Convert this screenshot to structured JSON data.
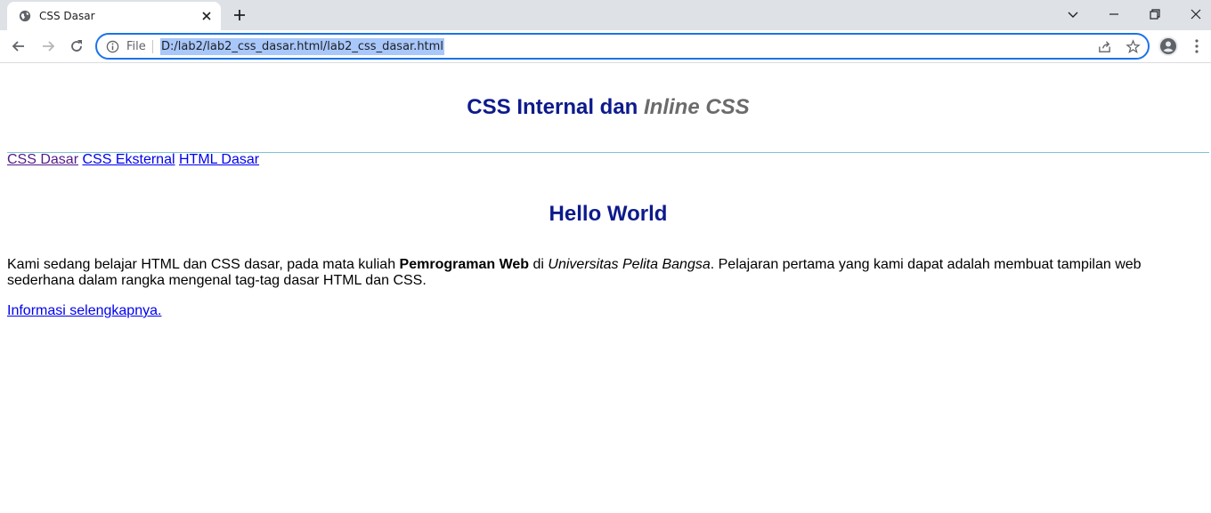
{
  "browser": {
    "tab_title": "CSS Dasar",
    "file_label": "File",
    "url": "D:/lab2/lab2_css_dasar.html/lab2_css_dasar.html",
    "accent_color": "#1a73e8"
  },
  "page": {
    "header": {
      "title_part1": "CSS Internal dan ",
      "title_part2": "Inline CSS"
    },
    "nav": [
      {
        "label": "CSS Dasar"
      },
      {
        "label": "CSS Eksternal"
      },
      {
        "label": "HTML Dasar"
      }
    ],
    "heading": "Hello World",
    "paragraph": {
      "text1": "Kami sedang belajar HTML dan CSS dasar, pada mata kuliah ",
      "bold": "Pemrograman Web",
      "text2": " di ",
      "italic": "Universitas Pelita Bangsa",
      "text3": ". Pelajaran pertama yang kami dapat adalah membuat tampilan web sederhana dalam rangka mengenal tag-tag dasar HTML dan CSS."
    },
    "more_link": "Informasi selengkapnya."
  }
}
